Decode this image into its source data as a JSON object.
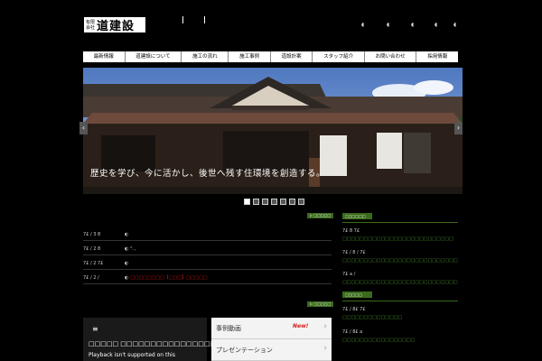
{
  "header": {
    "logo_small": "有限会社",
    "logo_text": "道建設",
    "sns_icons": [
      "sns-icon",
      "sns-icon",
      "sns-icon",
      "sns-icon",
      "sns-icon"
    ]
  },
  "nav": {
    "items": [
      "最新情報",
      "道建設について",
      "施工の流れ",
      "施工事例",
      "道設計案",
      "スタッフ紹介",
      "お問い合わせ",
      "採用情報"
    ]
  },
  "hero": {
    "caption": "歴史を学び、今に活かし、後世へ残す住環境を創造する。",
    "prev": "‹",
    "next": "›",
    "slide_count": 7,
    "active_slide": 1
  },
  "news": {
    "more_label": "▷ □□□□□",
    "rows": [
      {
        "date": "7£ / 3 8",
        "icon": "◐",
        "text": "",
        "red": false
      },
      {
        "date": "7£ / 2 8",
        "icon": "◐",
        "text": "ᵈ₋,",
        "red": false
      },
      {
        "date": "7£ / 2 7£",
        "icon": "◐",
        "text": "",
        "red": false
      },
      {
        "date": "7£ / 2 /",
        "icon": "◐",
        "text": "□□□□□□□□【□□□】□□□□□",
        "red": true
      }
    ]
  },
  "video_section": {
    "more_label": "▷ □□□□□",
    "video_title": "□□□□□ □□□□□□□□□□□□□□□□ (□□□□□",
    "video_note": "Playback isn't supported on this",
    "list": [
      {
        "label": "事例動画",
        "badge": "New!"
      },
      {
        "label": "プレゼンテーション",
        "badge": ""
      }
    ]
  },
  "sidebar": {
    "section1_title": "□□□□□□",
    "section1_entries": [
      {
        "date": "7£   8   7£",
        "text": "□□□□□□□□□□□□□□□□□□□□□□□□□□"
      },
      {
        "date": "7£ / 8 / 7£",
        "text": "□□□□□□□□□□□□□□□□□□□□□□□□□□□"
      },
      {
        "date": "7£   a      /",
        "text": "□□□□□□□□□□□□□□□□□□□□□□□□□□□"
      }
    ],
    "section2_title": "□□□□□",
    "section2_entries": [
      {
        "date": "7£ / 8£ 7£",
        "text": "□□□□□□□□□□□□□□"
      },
      {
        "date": "7£ / 8£   a",
        "text": "□□□□□□□□□□□□□□□□□"
      }
    ]
  },
  "colors": {
    "accent_green": "#3a6b1b",
    "link_green": "#4b9a2b",
    "alert_red": "#d31818"
  }
}
